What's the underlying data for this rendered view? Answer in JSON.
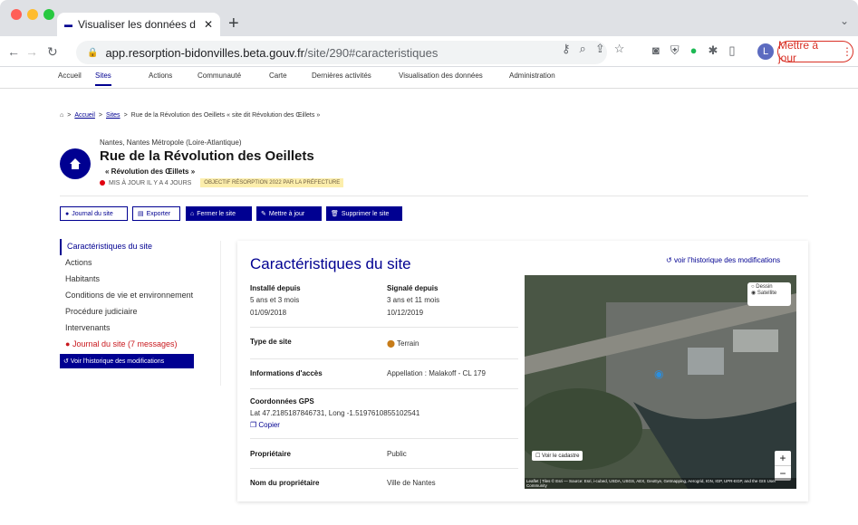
{
  "browser": {
    "tab_title": "Visualiser les données d'un site",
    "url_host": "app.resorption-bidonvilles.beta.gouv.fr",
    "url_path": "/site/290#caracteristiques",
    "update_label": "Mettre à jour",
    "avatar_letter": "L"
  },
  "nav": {
    "items": [
      "Accueil",
      "Sites",
      "Actions",
      "Communauté",
      "Carte",
      "Dernières activités",
      "Visualisation des données",
      "Administration"
    ]
  },
  "breadcrumb": {
    "home": "Accueil",
    "sites": "Sites",
    "current": "Rue de la Révolution des Oeillets « site dit Révolution des Œillets »"
  },
  "site": {
    "location": "Nantes, Nantes Métropole (Loire-Atlantique)",
    "title": "Rue de la Révolution des Oeillets",
    "subtitle": "« Révolution des Œillets »",
    "updated": "MIS À JOUR IL Y A 4 JOURS",
    "badge": "OBJECTIF RÉSORPTION 2022 PAR LA PRÉFECTURE"
  },
  "actions": {
    "journal": "Journal du site",
    "export": "Exporter",
    "close": "Fermer le site",
    "update": "Mettre à jour",
    "delete": "Supprimer le site"
  },
  "sidebar": {
    "items": [
      "Caractéristiques du site",
      "Actions",
      "Habitants",
      "Conditions de vie et environnement",
      "Procédure judiciaire",
      "Intervenants"
    ],
    "journal": "Journal du site (7 messages)",
    "history_btn": "Voir l'historique des modifications"
  },
  "card": {
    "title": "Caractéristiques du site",
    "history_link": "voir l'historique des modifications",
    "installed_label": "Installé depuis",
    "installed_duration": "5 ans et 3 mois",
    "installed_date": "01/09/2018",
    "reported_label": "Signalé depuis",
    "reported_duration": "3 ans et 11 mois",
    "reported_date": "10/12/2019",
    "type_label": "Type de site",
    "type_value": "Terrain",
    "access_label": "Informations d'accès",
    "access_value": "Appellation : Malakoff - CL 179",
    "gps_label": "Coordonnées GPS",
    "gps_value": "Lat 47.2185187846731, Long -1.5197610855102541",
    "copy_label": "Copier",
    "owner_label": "Propriétaire",
    "owner_value": "Public",
    "owner_name_label": "Nom du propriétaire",
    "owner_name_value": "Ville de Nantes"
  },
  "map": {
    "layer_dessin": "Dessin",
    "layer_satellite": "Satellite",
    "cadastre": "Voir le cadastre",
    "attribution": "Leaflet | Tiles © Esri — Source: Esri, i-cubed, USDA, USGS, AEX, GeoEye, Getmapping, Aerogrid, IGN, IGP, UPR-EGP, and the GIS User Community"
  }
}
